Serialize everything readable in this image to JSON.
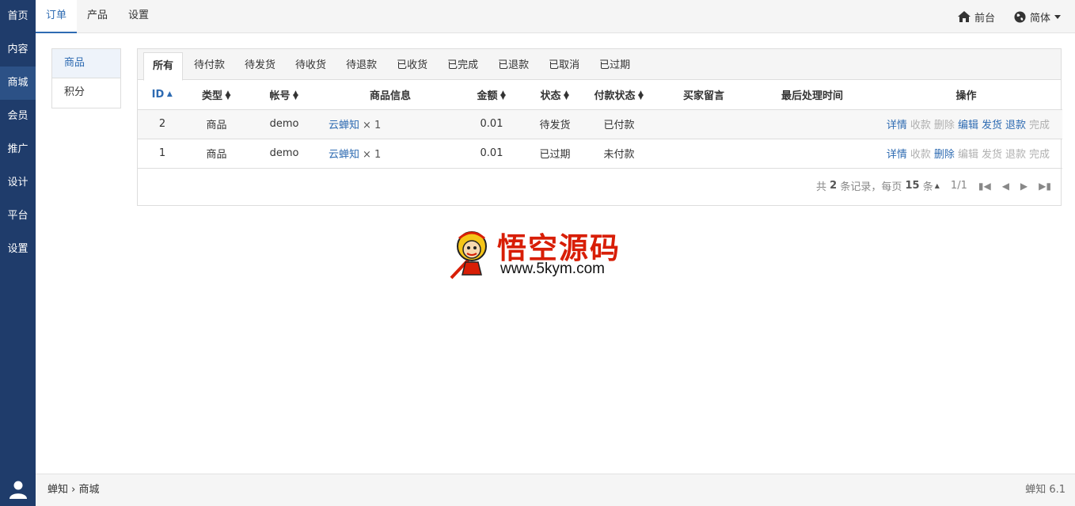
{
  "sidebar": {
    "items": [
      {
        "label": "首页"
      },
      {
        "label": "内容"
      },
      {
        "label": "商城"
      },
      {
        "label": "会员"
      },
      {
        "label": "推广"
      },
      {
        "label": "设计"
      },
      {
        "label": "平台"
      },
      {
        "label": "设置"
      }
    ],
    "active_index": 2,
    "user_icon": "user-icon"
  },
  "topbar": {
    "tabs": [
      {
        "label": "订单"
      },
      {
        "label": "产品"
      },
      {
        "label": "设置"
      }
    ],
    "active_tab": 0,
    "frontend_label": "前台",
    "frontend_icon": "home-icon",
    "language_label": "简体",
    "language_icon": "globe-icon"
  },
  "submenu": {
    "items": [
      {
        "label": "商品"
      },
      {
        "label": "积分"
      }
    ],
    "active_index": 0
  },
  "filters": {
    "items": [
      {
        "label": "所有"
      },
      {
        "label": "待付款"
      },
      {
        "label": "待发货"
      },
      {
        "label": "待收货"
      },
      {
        "label": "待退款"
      },
      {
        "label": "已收货"
      },
      {
        "label": "已完成"
      },
      {
        "label": "已退款"
      },
      {
        "label": "已取消"
      },
      {
        "label": "已过期"
      }
    ],
    "active_index": 0
  },
  "table": {
    "headers": {
      "id": "ID",
      "type": "类型",
      "account": "帐号",
      "goods": "商品信息",
      "amount": "金额",
      "status": "状态",
      "pay_status": "付款状态",
      "message": "买家留言",
      "last_time": "最后处理时间",
      "ops": "操作"
    },
    "rows": [
      {
        "id": "2",
        "type": "商品",
        "account": "demo",
        "goods": "云蝉知",
        "qty": "× 1",
        "amount": "0.01",
        "status": "待发货",
        "pay_status": "已付款",
        "message": "",
        "last_time": "",
        "ops": [
          {
            "label": "详情",
            "enabled": true
          },
          {
            "label": "收款",
            "enabled": false
          },
          {
            "label": "删除",
            "enabled": false
          },
          {
            "label": "编辑",
            "enabled": true
          },
          {
            "label": "发货",
            "enabled": true
          },
          {
            "label": "退款",
            "enabled": true
          },
          {
            "label": "完成",
            "enabled": false
          }
        ]
      },
      {
        "id": "1",
        "type": "商品",
        "account": "demo",
        "goods": "云蝉知",
        "qty": "× 1",
        "amount": "0.01",
        "status": "已过期",
        "pay_status": "未付款",
        "message": "",
        "last_time": "",
        "ops": [
          {
            "label": "详情",
            "enabled": true
          },
          {
            "label": "收款",
            "enabled": false
          },
          {
            "label": "删除",
            "enabled": true
          },
          {
            "label": "编辑",
            "enabled": false
          },
          {
            "label": "发货",
            "enabled": false
          },
          {
            "label": "退款",
            "enabled": false
          },
          {
            "label": "完成",
            "enabled": false
          }
        ]
      }
    ]
  },
  "pager": {
    "prefix": "共",
    "total": "2",
    "mid": "条记录，每页",
    "per_page": "15",
    "suffix": "条",
    "page": "1/1"
  },
  "watermark": {
    "title": "悟空源码",
    "url": "www.5kym.com"
  },
  "footer": {
    "crumb_root": "蝉知",
    "crumb_sep": "›",
    "crumb_current": "商城",
    "version": "蝉知 6.1"
  },
  "colors": {
    "sidebar_bg": "#1f3c6b",
    "accent": "#2e6bb2",
    "watermark_red": "#d81e06"
  }
}
